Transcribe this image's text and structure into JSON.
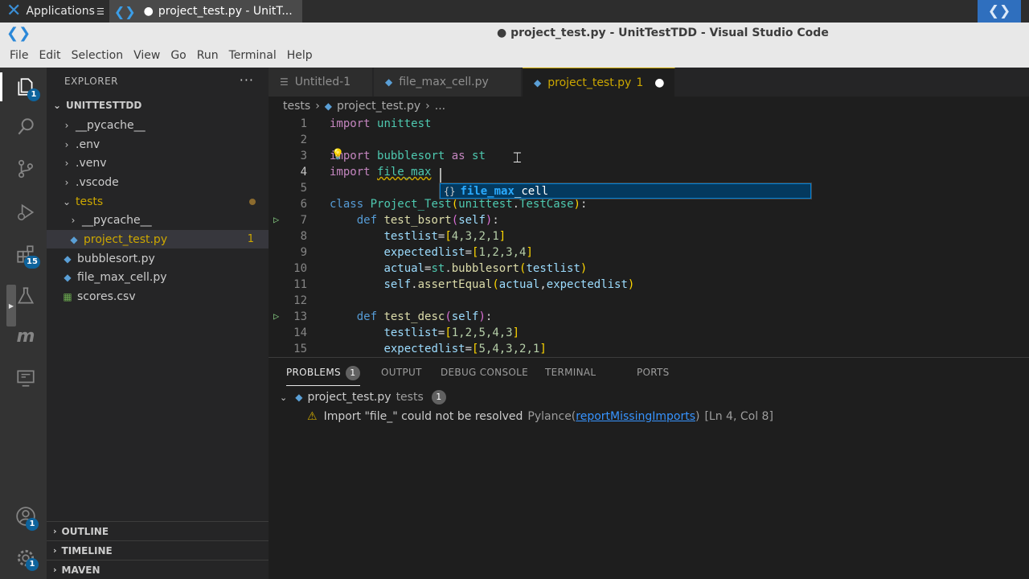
{
  "taskbar": {
    "applications": "Applications",
    "apps_sep": "☰",
    "window_item": "project_test.py - UnitT...",
    "window_dot": "●"
  },
  "titlebar": {
    "title": "● project_test.py - UnitTestTDD - Visual Studio Code"
  },
  "menu": [
    "File",
    "Edit",
    "Selection",
    "View",
    "Go",
    "Run",
    "Terminal",
    "Help"
  ],
  "activity": {
    "explorer_badge": "1",
    "extensions_badge": "15",
    "accounts_badge": "1",
    "manage_badge": "1"
  },
  "explorer": {
    "title": "EXPLORER",
    "more": "···",
    "root": "UNITTESTTDD",
    "items": [
      {
        "label": "__pycache__"
      },
      {
        "label": ".env"
      },
      {
        "label": ".venv"
      },
      {
        "label": ".vscode"
      },
      {
        "label": "tests"
      },
      {
        "label": "__pycache__"
      },
      {
        "label": "project_test.py",
        "count": "1"
      },
      {
        "label": "bubblesort.py"
      },
      {
        "label": "file_max_cell.py"
      },
      {
        "label": "scores.csv"
      }
    ],
    "sections": [
      "OUTLINE",
      "TIMELINE",
      "MAVEN"
    ]
  },
  "tabs": [
    {
      "label": "Untitled-1"
    },
    {
      "label": "file_max_cell.py"
    },
    {
      "label": "project_test.py",
      "count": "1"
    }
  ],
  "breadcrumb": [
    "tests",
    "project_test.py",
    "..."
  ],
  "editor": {
    "line_numbers": [
      "1",
      "2",
      "3",
      "4",
      "5",
      "6",
      "7",
      "8",
      "9",
      "10",
      "11",
      "12",
      "13",
      "14",
      "15"
    ],
    "l1": {
      "kw": "import",
      "mod": "unittest"
    },
    "l3": {
      "kw": "import",
      "mod": "bubblesort",
      "as": "as",
      "alias": "st"
    },
    "l4": {
      "kw": "import",
      "typed": "file_max"
    },
    "l6": {
      "kw": "class",
      "name": "Project_Test",
      "base_mod": "unittest",
      "base": "TestCase"
    },
    "l7": {
      "kw": "def",
      "fn": "test_bsort",
      "arg": "self"
    },
    "l8": {
      "var": "testlist",
      "vals": "4,3,2,1"
    },
    "l9": {
      "var": "expectedlist",
      "vals": "1,2,3,4"
    },
    "l10": {
      "var": "actual",
      "obj": "st",
      "fn": "bubblesort",
      "arg": "testlist"
    },
    "l11": {
      "obj": "self",
      "fn": "assertEqual",
      "a1": "actual",
      "a2": "expectedlist"
    },
    "l13": {
      "kw": "def",
      "fn": "test_desc",
      "arg": "self"
    },
    "l14": {
      "var": "testlist",
      "vals": "1,2,5,4,3"
    },
    "l15": {
      "var": "expectedlist",
      "vals": "5,4,3,2,1"
    }
  },
  "suggest": {
    "icon": "{}",
    "match": "file_max",
    "rest": "_cell"
  },
  "panel": {
    "tabs": [
      "PROBLEMS",
      "OUTPUT",
      "DEBUG CONSOLE",
      "TERMINAL",
      "PORTS"
    ],
    "problems_count": "1",
    "file": "project_test.py",
    "folder": "tests",
    "file_count": "1",
    "message": "Import \"file_\" could not be resolved",
    "source": "Pylance(",
    "rule": "reportMissingImports",
    "source_end": ")",
    "location": "[Ln 4, Col 8]"
  }
}
